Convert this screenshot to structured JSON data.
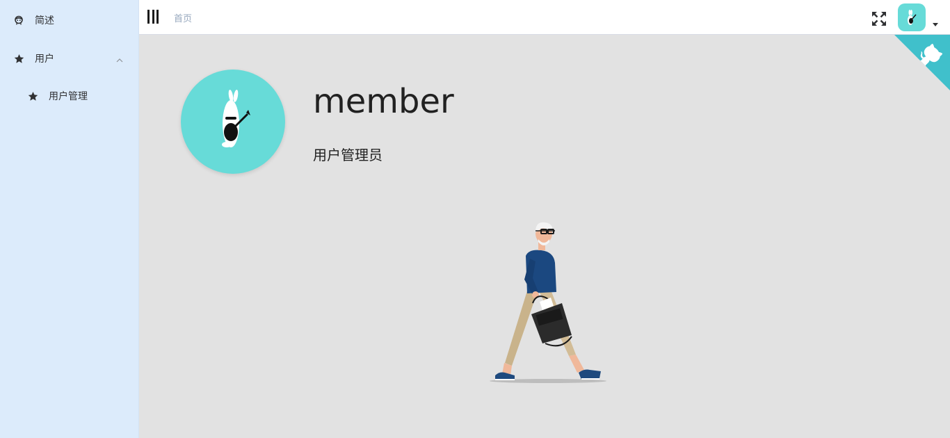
{
  "sidebar": {
    "items": [
      {
        "label": "简述",
        "icon": "face-icon"
      },
      {
        "label": "用户",
        "icon": "star-icon",
        "expanded": true,
        "children": [
          {
            "label": "用户管理",
            "icon": "star-icon"
          }
        ]
      }
    ]
  },
  "header": {
    "breadcrumb": "首页"
  },
  "profile": {
    "name": "member",
    "role": "用户管理员"
  },
  "colors": {
    "sidebar_bg": "#dcebfb",
    "main_bg": "#e2e2e2",
    "avatar_bg": "#67dbd8",
    "github_corner": "#40c0cb"
  }
}
